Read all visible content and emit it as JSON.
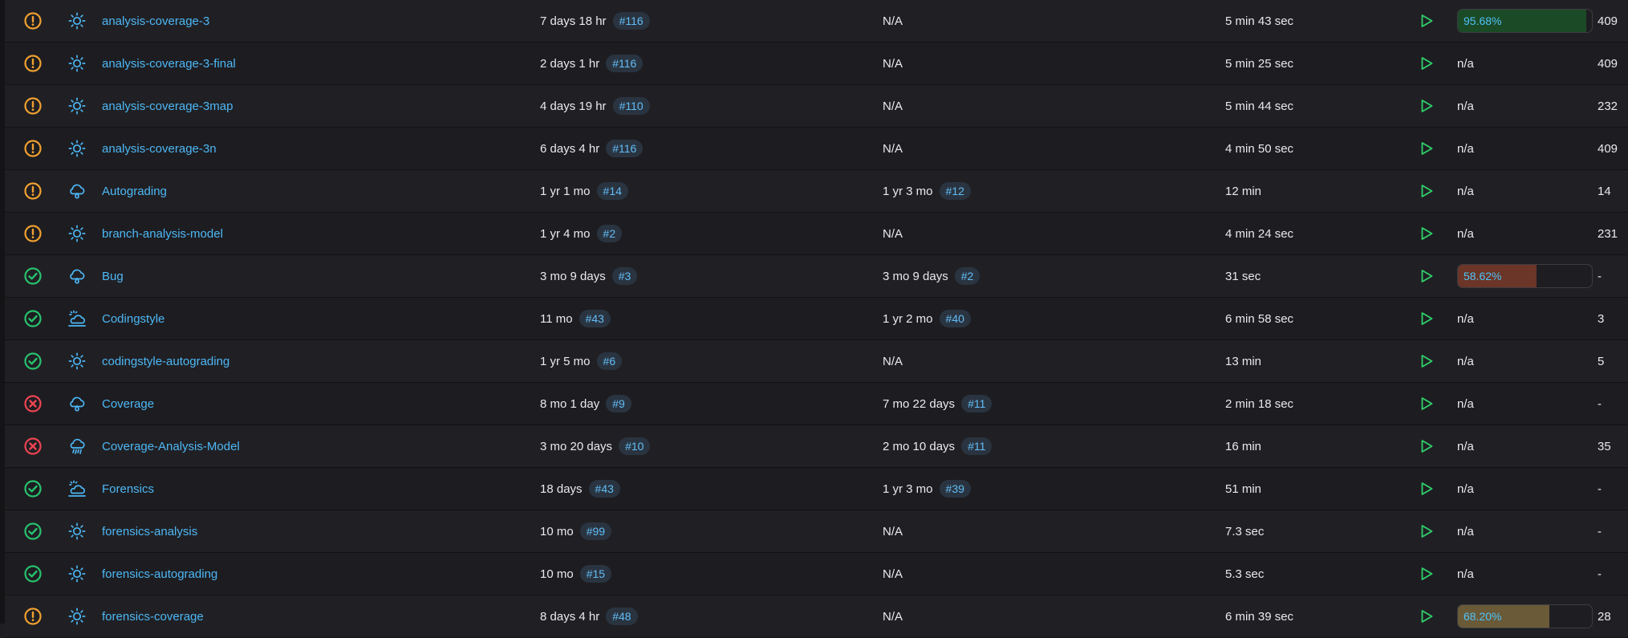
{
  "colors": {
    "warning": "#f0a030",
    "success": "#27c26e",
    "failure": "#ef4352",
    "link": "#4db7f5",
    "run": "#2fcf6a",
    "bar_good": "#1b4a26",
    "bar_bad": "#6b3527",
    "bar_mid": "#6a5a38"
  },
  "rows": [
    {
      "status": "warning",
      "weather": "sun-icon",
      "name": "analysis-coverage-3",
      "last_success": "7 days 18 hr",
      "success_build": "#116",
      "last_failure": "N/A",
      "failure_build": "",
      "duration": "5 min 43 sec",
      "coverage": {
        "label": "95.68%",
        "value": 0.9568,
        "level": "good"
      },
      "count": "409"
    },
    {
      "status": "warning",
      "weather": "sun-icon",
      "name": "analysis-coverage-3-final",
      "last_success": "2 days 1 hr",
      "success_build": "#116",
      "last_failure": "N/A",
      "failure_build": "",
      "duration": "5 min 25 sec",
      "coverage": {
        "label": "n/a"
      },
      "count": "409"
    },
    {
      "status": "warning",
      "weather": "sun-icon",
      "name": "analysis-coverage-3map",
      "last_success": "4 days 19 hr",
      "success_build": "#110",
      "last_failure": "N/A",
      "failure_build": "",
      "duration": "5 min 44 sec",
      "coverage": {
        "label": "n/a"
      },
      "count": "232"
    },
    {
      "status": "warning",
      "weather": "sun-icon",
      "name": "analysis-coverage-3n",
      "last_success": "6 days 4 hr",
      "success_build": "#116",
      "last_failure": "N/A",
      "failure_build": "",
      "duration": "4 min 50 sec",
      "coverage": {
        "label": "n/a"
      },
      "count": "409"
    },
    {
      "status": "warning",
      "weather": "cloud-drizzle-icon",
      "name": "Autograding",
      "last_success": "1 yr 1 mo",
      "success_build": "#14",
      "last_failure": "1 yr 3 mo",
      "failure_build": "#12",
      "duration": "12 min",
      "coverage": {
        "label": "n/a"
      },
      "count": "14"
    },
    {
      "status": "warning",
      "weather": "sun-icon",
      "name": "branch-analysis-model",
      "last_success": "1 yr 4 mo",
      "success_build": "#2",
      "last_failure": "N/A",
      "failure_build": "",
      "duration": "4 min 24 sec",
      "coverage": {
        "label": "n/a"
      },
      "count": "231"
    },
    {
      "status": "success",
      "weather": "cloud-drizzle-icon",
      "name": "Bug",
      "last_success": "3 mo 9 days",
      "success_build": "#3",
      "last_failure": "3 mo 9 days",
      "failure_build": "#2",
      "duration": "31 sec",
      "coverage": {
        "label": "58.62%",
        "value": 0.5862,
        "level": "bad"
      },
      "count": "-"
    },
    {
      "status": "success",
      "weather": "partly-cloudy-icon",
      "name": "Codingstyle",
      "last_success": "11 mo",
      "success_build": "#43",
      "last_failure": "1 yr 2 mo",
      "failure_build": "#40",
      "duration": "6 min 58 sec",
      "coverage": {
        "label": "n/a"
      },
      "count": "3"
    },
    {
      "status": "success",
      "weather": "sun-icon",
      "name": "codingstyle-autograding",
      "last_success": "1 yr 5 mo",
      "success_build": "#6",
      "last_failure": "N/A",
      "failure_build": "",
      "duration": "13 min",
      "coverage": {
        "label": "n/a"
      },
      "count": "5"
    },
    {
      "status": "failure",
      "weather": "cloud-drizzle-icon",
      "name": "Coverage",
      "last_success": "8 mo 1 day",
      "success_build": "#9",
      "last_failure": "7 mo 22 days",
      "failure_build": "#11",
      "duration": "2 min 18 sec",
      "coverage": {
        "label": "n/a"
      },
      "count": "-"
    },
    {
      "status": "failure",
      "weather": "rain-icon",
      "name": "Coverage-Analysis-Model",
      "last_success": "3 mo 20 days",
      "success_build": "#10",
      "last_failure": "2 mo 10 days",
      "failure_build": "#11",
      "duration": "16 min",
      "coverage": {
        "label": "n/a"
      },
      "count": "35"
    },
    {
      "status": "success",
      "weather": "partly-cloudy-icon",
      "name": "Forensics",
      "last_success": "18 days",
      "success_build": "#43",
      "last_failure": "1 yr 3 mo",
      "failure_build": "#39",
      "duration": "51 min",
      "coverage": {
        "label": "n/a"
      },
      "count": "-"
    },
    {
      "status": "success",
      "weather": "sun-icon",
      "name": "forensics-analysis",
      "last_success": "10 mo",
      "success_build": "#99",
      "last_failure": "N/A",
      "failure_build": "",
      "duration": "7.3 sec",
      "coverage": {
        "label": "n/a"
      },
      "count": "-"
    },
    {
      "status": "success",
      "weather": "sun-icon",
      "name": "forensics-autograding",
      "last_success": "10 mo",
      "success_build": "#15",
      "last_failure": "N/A",
      "failure_build": "",
      "duration": "5.3 sec",
      "coverage": {
        "label": "n/a"
      },
      "count": "-"
    },
    {
      "status": "warning",
      "weather": "sun-icon",
      "name": "forensics-coverage",
      "last_success": "8 days 4 hr",
      "success_build": "#48",
      "last_failure": "N/A",
      "failure_build": "",
      "duration": "6 min 39 sec",
      "coverage": {
        "label": "68.20%",
        "value": 0.682,
        "level": "mid"
      },
      "count": "28"
    }
  ]
}
